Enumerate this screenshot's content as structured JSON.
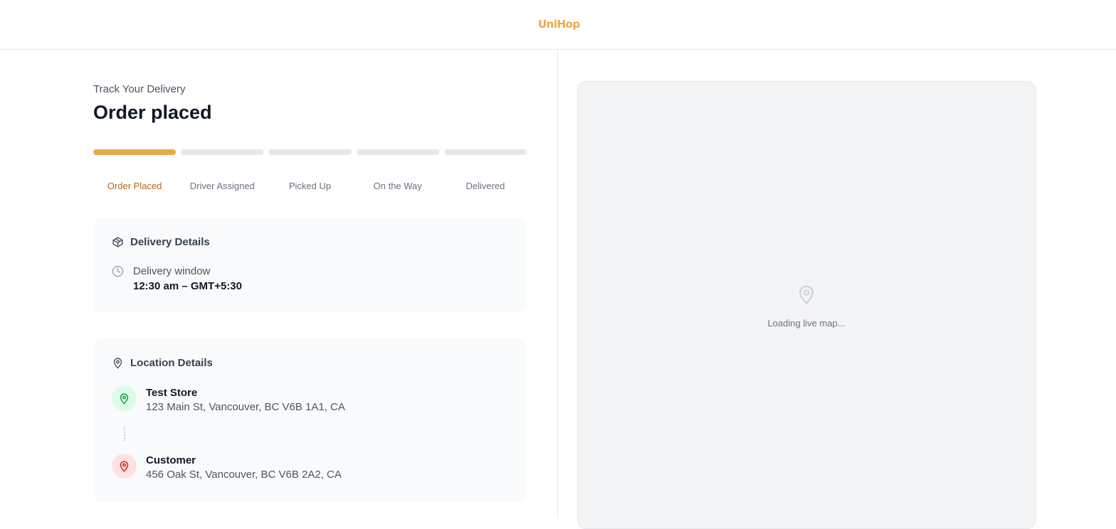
{
  "header": {
    "logo_text": "UniHop",
    "logo_icon": "bunny-ears-icon",
    "brand_color": "#e9a94a"
  },
  "tracking": {
    "subtitle": "Track Your Delivery",
    "title": "Order placed",
    "progress_steps_completed": 1,
    "steps": [
      "Order Placed",
      "Driver Assigned",
      "Picked Up",
      "On the Way",
      "Delivered"
    ]
  },
  "delivery_details": {
    "heading": "Delivery Details",
    "window_label": "Delivery window",
    "window_value": "12:30 am – GMT+5:30"
  },
  "location_details": {
    "heading": "Location Details",
    "store_name": "Test Store",
    "store_address": "123 Main St, Vancouver, BC V6B 1A1, CA",
    "customer_name": "Customer",
    "customer_address": "456 Oak St, Vancouver, BC V6B 2A2, CA",
    "pickup_color": "#22a34a",
    "dropoff_color": "#dc2626"
  },
  "map": {
    "loading_text": "Loading live map..."
  }
}
